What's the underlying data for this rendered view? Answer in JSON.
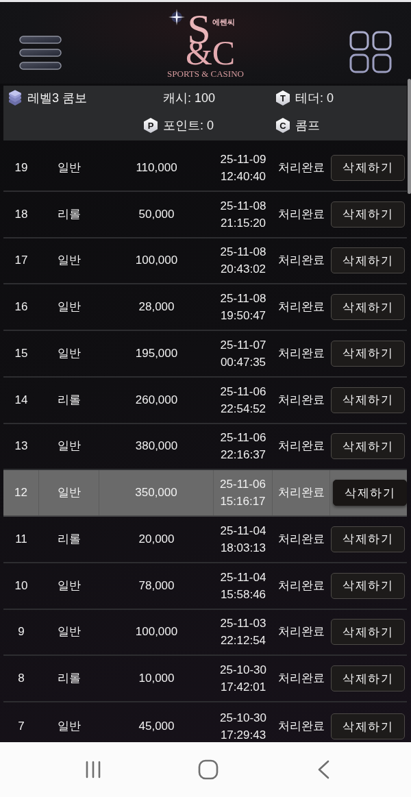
{
  "logo": {
    "mark_top": "S",
    "mark_bottom": "&C",
    "korean": "에쎈씨",
    "tagline": "SPORTS & CASINO"
  },
  "account": [
    {
      "kind": "level",
      "text": "레벨3 쿰보"
    },
    {
      "kind": "cash",
      "text": "캐시: 100"
    },
    {
      "kind": "tether",
      "badge": "T",
      "text": "테더: 0"
    },
    {
      "kind": "point",
      "badge": "P",
      "text": "포인트: 0"
    },
    {
      "kind": "comp",
      "badge": "C",
      "text": "콤프"
    }
  ],
  "rows": [
    {
      "no": "19",
      "type": "일반",
      "amount": "110,000",
      "date": "25-11-09",
      "time": "12:40:40",
      "status": "처리완료",
      "action": "삭제하기",
      "selected": false
    },
    {
      "no": "18",
      "type": "리롤",
      "amount": "50,000",
      "date": "25-11-08",
      "time": "21:15:20",
      "status": "처리완료",
      "action": "삭제하기",
      "selected": false
    },
    {
      "no": "17",
      "type": "일반",
      "amount": "100,000",
      "date": "25-11-08",
      "time": "20:43:02",
      "status": "처리완료",
      "action": "삭제하기",
      "selected": false
    },
    {
      "no": "16",
      "type": "일반",
      "amount": "28,000",
      "date": "25-11-08",
      "time": "19:50:47",
      "status": "처리완료",
      "action": "삭제하기",
      "selected": false
    },
    {
      "no": "15",
      "type": "일반",
      "amount": "195,000",
      "date": "25-11-07",
      "time": "00:47:35",
      "status": "처리완료",
      "action": "삭제하기",
      "selected": false
    },
    {
      "no": "14",
      "type": "리롤",
      "amount": "260,000",
      "date": "25-11-06",
      "time": "22:54:52",
      "status": "처리완료",
      "action": "삭제하기",
      "selected": false
    },
    {
      "no": "13",
      "type": "일반",
      "amount": "380,000",
      "date": "25-11-06",
      "time": "22:16:37",
      "status": "처리완료",
      "action": "삭제하기",
      "selected": false
    },
    {
      "no": "12",
      "type": "일반",
      "amount": "350,000",
      "date": "25-11-06",
      "time": "15:16:17",
      "status": "처리완료",
      "action": "삭제하기",
      "selected": true
    },
    {
      "no": "11",
      "type": "리롤",
      "amount": "20,000",
      "date": "25-11-04",
      "time": "18:03:13",
      "status": "처리완료",
      "action": "삭제하기",
      "selected": false
    },
    {
      "no": "10",
      "type": "일반",
      "amount": "78,000",
      "date": "25-11-04",
      "time": "15:58:46",
      "status": "처리완료",
      "action": "삭제하기",
      "selected": false
    },
    {
      "no": "9",
      "type": "일반",
      "amount": "100,000",
      "date": "25-11-03",
      "time": "22:12:54",
      "status": "처리완료",
      "action": "삭제하기",
      "selected": false
    },
    {
      "no": "8",
      "type": "리롤",
      "amount": "10,000",
      "date": "25-10-30",
      "time": "17:42:01",
      "status": "처리완료",
      "action": "삭제하기",
      "selected": false
    },
    {
      "no": "7",
      "type": "일반",
      "amount": "45,000",
      "date": "25-10-30",
      "time": "17:29:43",
      "status": "처리완료",
      "action": "삭제하기",
      "selected": false
    }
  ]
}
